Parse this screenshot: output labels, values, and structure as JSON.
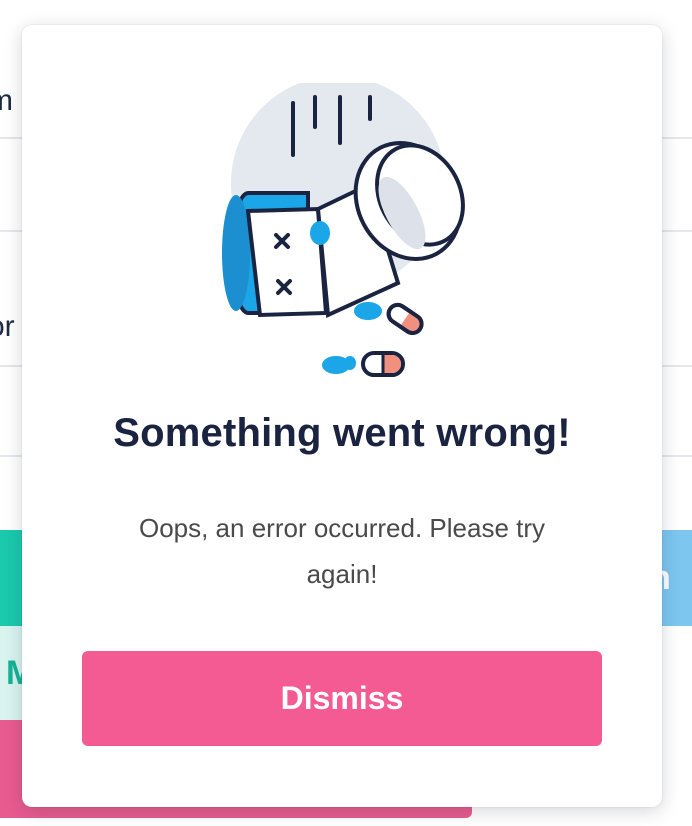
{
  "background": {
    "fragments": [
      "m",
      "or"
    ],
    "teal_fragment": "M",
    "blue_fragment": "n"
  },
  "modal": {
    "illustration_icon": "spilled-pill-bottle-icon",
    "title": "Something went wrong!",
    "message": "Oops, an error occurred. Please try again!",
    "dismiss_label": "Dismiss"
  },
  "colors": {
    "title": "#1a2340",
    "button": "#f45b92",
    "accent_blue": "#1ba6e8",
    "pill_red": "#f1907f",
    "circle_bg": "#e4e8ef"
  }
}
